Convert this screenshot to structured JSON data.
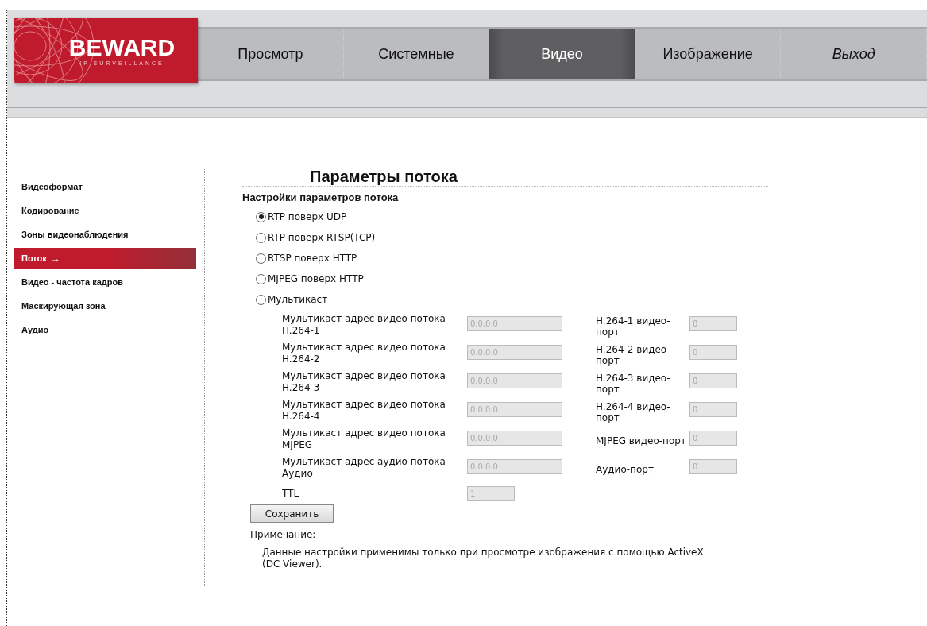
{
  "logo": {
    "brand": "BEWARD",
    "tagline": "IP SURVEILLANCE"
  },
  "tabs": [
    {
      "label": "Просмотр",
      "selected": false,
      "italic": false
    },
    {
      "label": "Системные",
      "selected": false,
      "italic": false
    },
    {
      "label": "Видео",
      "selected": true,
      "italic": false
    },
    {
      "label": "Изображение",
      "selected": false,
      "italic": false
    },
    {
      "label": "Выход",
      "selected": false,
      "italic": true
    }
  ],
  "sidebar": {
    "items": [
      {
        "label": "Видеоформат",
        "selected": false
      },
      {
        "label": "Кодирование",
        "selected": false
      },
      {
        "label": "Зоны видеонаблюдения",
        "selected": false
      },
      {
        "label": "Поток",
        "selected": true,
        "arrow": "→"
      },
      {
        "label": "Видео - частота кадров",
        "selected": false
      },
      {
        "label": "Маскирующая зона",
        "selected": false
      },
      {
        "label": "Аудио",
        "selected": false
      }
    ]
  },
  "title": "Параметры потока",
  "section_title": "Настройки параметров потока",
  "protocols": [
    {
      "label": "RTP поверх UDP",
      "selected": true
    },
    {
      "label": "RTP поверх RTSP(TCP)",
      "selected": false
    },
    {
      "label": "RTSP поверх HTTP",
      "selected": false
    },
    {
      "label": "MJPEG поверх HTTP",
      "selected": false
    },
    {
      "label": "Мультикаст",
      "selected": false
    }
  ],
  "multicast_rows": [
    {
      "address_label": "Мультикаст адрес видео потока H.264-1",
      "address": "0.0.0.0",
      "port_label": "H.264-1 видео-порт",
      "port": "0"
    },
    {
      "address_label": "Мультикаст адрес видео потока H.264-2",
      "address": "0.0.0.0",
      "port_label": "H.264-2 видео-порт",
      "port": "0"
    },
    {
      "address_label": "Мультикаст адрес видео потока H.264-3",
      "address": "0.0.0.0",
      "port_label": "H.264-3 видео-порт",
      "port": "0"
    },
    {
      "address_label": "Мультикаст адрес видео потока H.264-4",
      "address": "0.0.0.0",
      "port_label": "H.264-4 видео-порт",
      "port": "0"
    },
    {
      "address_label": "Мультикаст адрес видео потока MJPEG",
      "address": "0.0.0.0",
      "port_label": "MJPEG видео-порт",
      "port": "0"
    },
    {
      "address_label": "Мультикаст адрес аудио потока Аудио",
      "address": "0.0.0.0",
      "port_label": "Аудио-порт",
      "port": "0"
    }
  ],
  "ttl": {
    "label": "TTL",
    "value": "1"
  },
  "save_button": "Сохранить",
  "note": {
    "heading": "Примечание:",
    "text": "Данные настройки применимы только при просмотре изображения с помощью ActiveX (DC Viewer)."
  }
}
